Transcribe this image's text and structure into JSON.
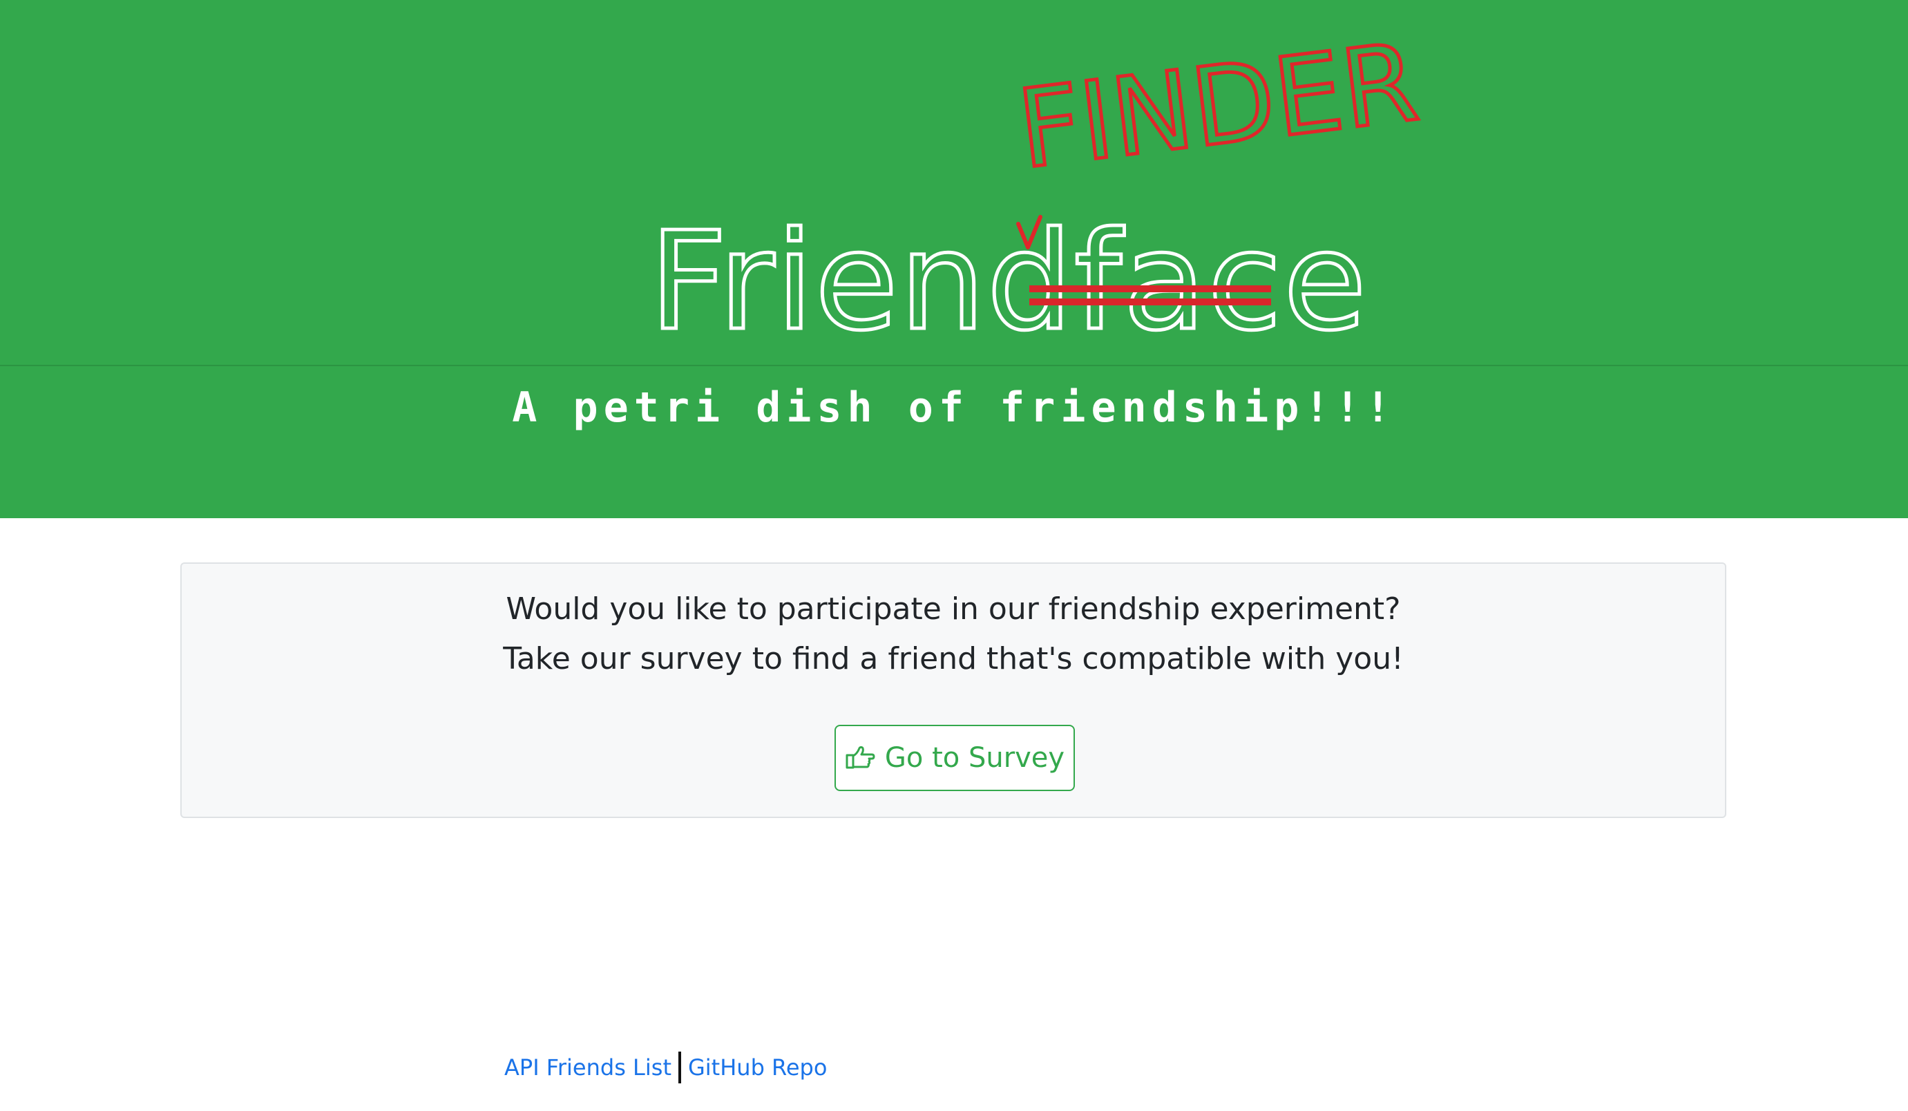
{
  "header": {
    "logo_main": "Friend",
    "logo_struck": "face",
    "logo_correction": "FINDER",
    "tagline": "A petri dish of friendship!!!"
  },
  "card": {
    "line1": "Would you like to participate in our friendship experiment?",
    "line2": "Take our survey to find a friend that's compatible with you!",
    "button_label": "Go to Survey",
    "button_icon": "hand-pointing-right-icon"
  },
  "footer": {
    "link1": "API Friends List",
    "link2": "GitHub Repo"
  },
  "colors": {
    "hero_bg": "#33a84c",
    "accent_green": "#33a84c",
    "correction_red": "#e0262a",
    "link_blue": "#1a73e8"
  }
}
